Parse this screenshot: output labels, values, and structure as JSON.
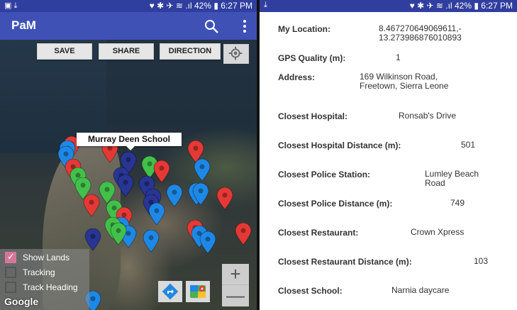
{
  "left": {
    "status": {
      "time": "6:27 PM",
      "battery": "42%",
      "indicators": "▣ ⤓",
      "icons": "♥ ✱ ✈ ≋ .ıl"
    },
    "app_title": "PaM",
    "buttons": {
      "save": "SAVE",
      "share": "SHARE",
      "direction": "DIRECTION"
    },
    "callout": "Murray Deen School",
    "layers": [
      {
        "label": "Show Lands",
        "checked": true
      },
      {
        "label": "Tracking",
        "checked": false
      },
      {
        "label": "Track Heading",
        "checked": false
      }
    ],
    "zoom_in": "+",
    "zoom_out": "—",
    "attribution": "Google",
    "colors": {
      "red": "#e53935",
      "green": "#43c04a",
      "blue": "#1e88e5",
      "navy": "#283593"
    },
    "pins": [
      {
        "c": "red"
      },
      {
        "c": "blue"
      },
      {
        "c": "red"
      },
      {
        "c": "red"
      },
      {
        "c": "blue"
      },
      {
        "c": "red"
      },
      {
        "c": "navy"
      },
      {
        "c": "green"
      },
      {
        "c": "red"
      },
      {
        "c": "blue"
      },
      {
        "c": "navy"
      },
      {
        "c": "green"
      },
      {
        "c": "green"
      },
      {
        "c": "navy"
      },
      {
        "c": "navy"
      },
      {
        "c": "green"
      },
      {
        "c": "navy"
      },
      {
        "c": "blue"
      },
      {
        "c": "blue"
      },
      {
        "c": "red"
      },
      {
        "c": "red"
      },
      {
        "c": "green"
      },
      {
        "c": "navy"
      },
      {
        "c": "blue"
      },
      {
        "c": "blue"
      },
      {
        "c": "red"
      },
      {
        "c": "blue"
      },
      {
        "c": "blue"
      },
      {
        "c": "green"
      },
      {
        "c": "green"
      },
      {
        "c": "navy"
      },
      {
        "c": "blue"
      },
      {
        "c": "red"
      },
      {
        "c": "blue"
      },
      {
        "c": "red"
      },
      {
        "c": "blue"
      },
      {
        "c": "blue"
      }
    ]
  },
  "right": {
    "status": {
      "time": "6:27 PM",
      "battery": "42%",
      "indicators": "⤓",
      "icons": "♥ ✱ ✈ ≋ .ıl"
    },
    "rows": [
      {
        "label": "My Location:",
        "value": "8.467270649069611,-\n13.273986876010893"
      },
      {
        "label": "GPS Quality (m):",
        "value": "1"
      },
      {
        "label": "Address:",
        "value": "169 Wilkinson Road,\nFreetown, Sierra Leone"
      },
      {
        "label": "Closest Hospital:",
        "value": "Ronsab's Drive"
      },
      {
        "label": "Closest Hospital Distance (m):",
        "value": "501"
      },
      {
        "label": "Closest Police Station:",
        "value": "Lumley Beach\nRoad"
      },
      {
        "label": "Closest Police Distance (m):",
        "value": "749"
      },
      {
        "label": "Closest Restaurant:",
        "value": "Crown Xpress"
      },
      {
        "label": "Closest Restaurant Distance (m):",
        "value": "103"
      },
      {
        "label": "Closest School:",
        "value": "Narnia daycare"
      }
    ]
  }
}
